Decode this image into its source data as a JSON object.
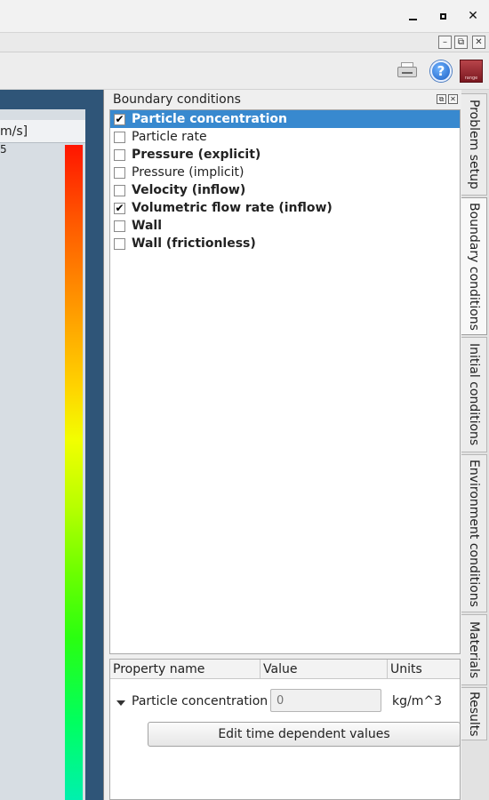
{
  "window": {
    "minimize": "minimize",
    "maximize": "maximize",
    "close": "✕"
  },
  "mdi": {
    "minimize": "–",
    "restore": "⧉",
    "close": "✕"
  },
  "toolbar": {
    "brand_text": "range"
  },
  "legend": {
    "unit_label": "m/s]",
    "top_value": "5"
  },
  "dock": {
    "title": "Boundary conditions",
    "items": [
      {
        "label": "Particle concentration",
        "checked": true,
        "bold": true,
        "selected": true
      },
      {
        "label": "Particle rate",
        "checked": false,
        "bold": false,
        "selected": false
      },
      {
        "label": "Pressure (explicit)",
        "checked": false,
        "bold": true,
        "selected": false
      },
      {
        "label": "Pressure (implicit)",
        "checked": false,
        "bold": false,
        "selected": false
      },
      {
        "label": "Velocity (inflow)",
        "checked": false,
        "bold": true,
        "selected": false
      },
      {
        "label": "Volumetric flow rate (inflow)",
        "checked": true,
        "bold": true,
        "selected": false
      },
      {
        "label": "Wall",
        "checked": false,
        "bold": true,
        "selected": false
      },
      {
        "label": "Wall (frictionless)",
        "checked": false,
        "bold": true,
        "selected": false
      }
    ],
    "properties": {
      "headers": {
        "name": "Property name",
        "value": "Value",
        "units": "Units"
      },
      "row": {
        "name": "Particle concentration",
        "placeholder": "0",
        "units": "kg/m^3"
      },
      "edit_button": "Edit time dependent values"
    }
  },
  "tabs": [
    "Problem setup",
    "Boundary conditions",
    "Initial conditions",
    "Environment conditions",
    "Materials",
    "Results"
  ],
  "active_tab": "Boundary conditions",
  "colors": {
    "selection": "#3889cf",
    "dark_panel": "#2f5578"
  }
}
